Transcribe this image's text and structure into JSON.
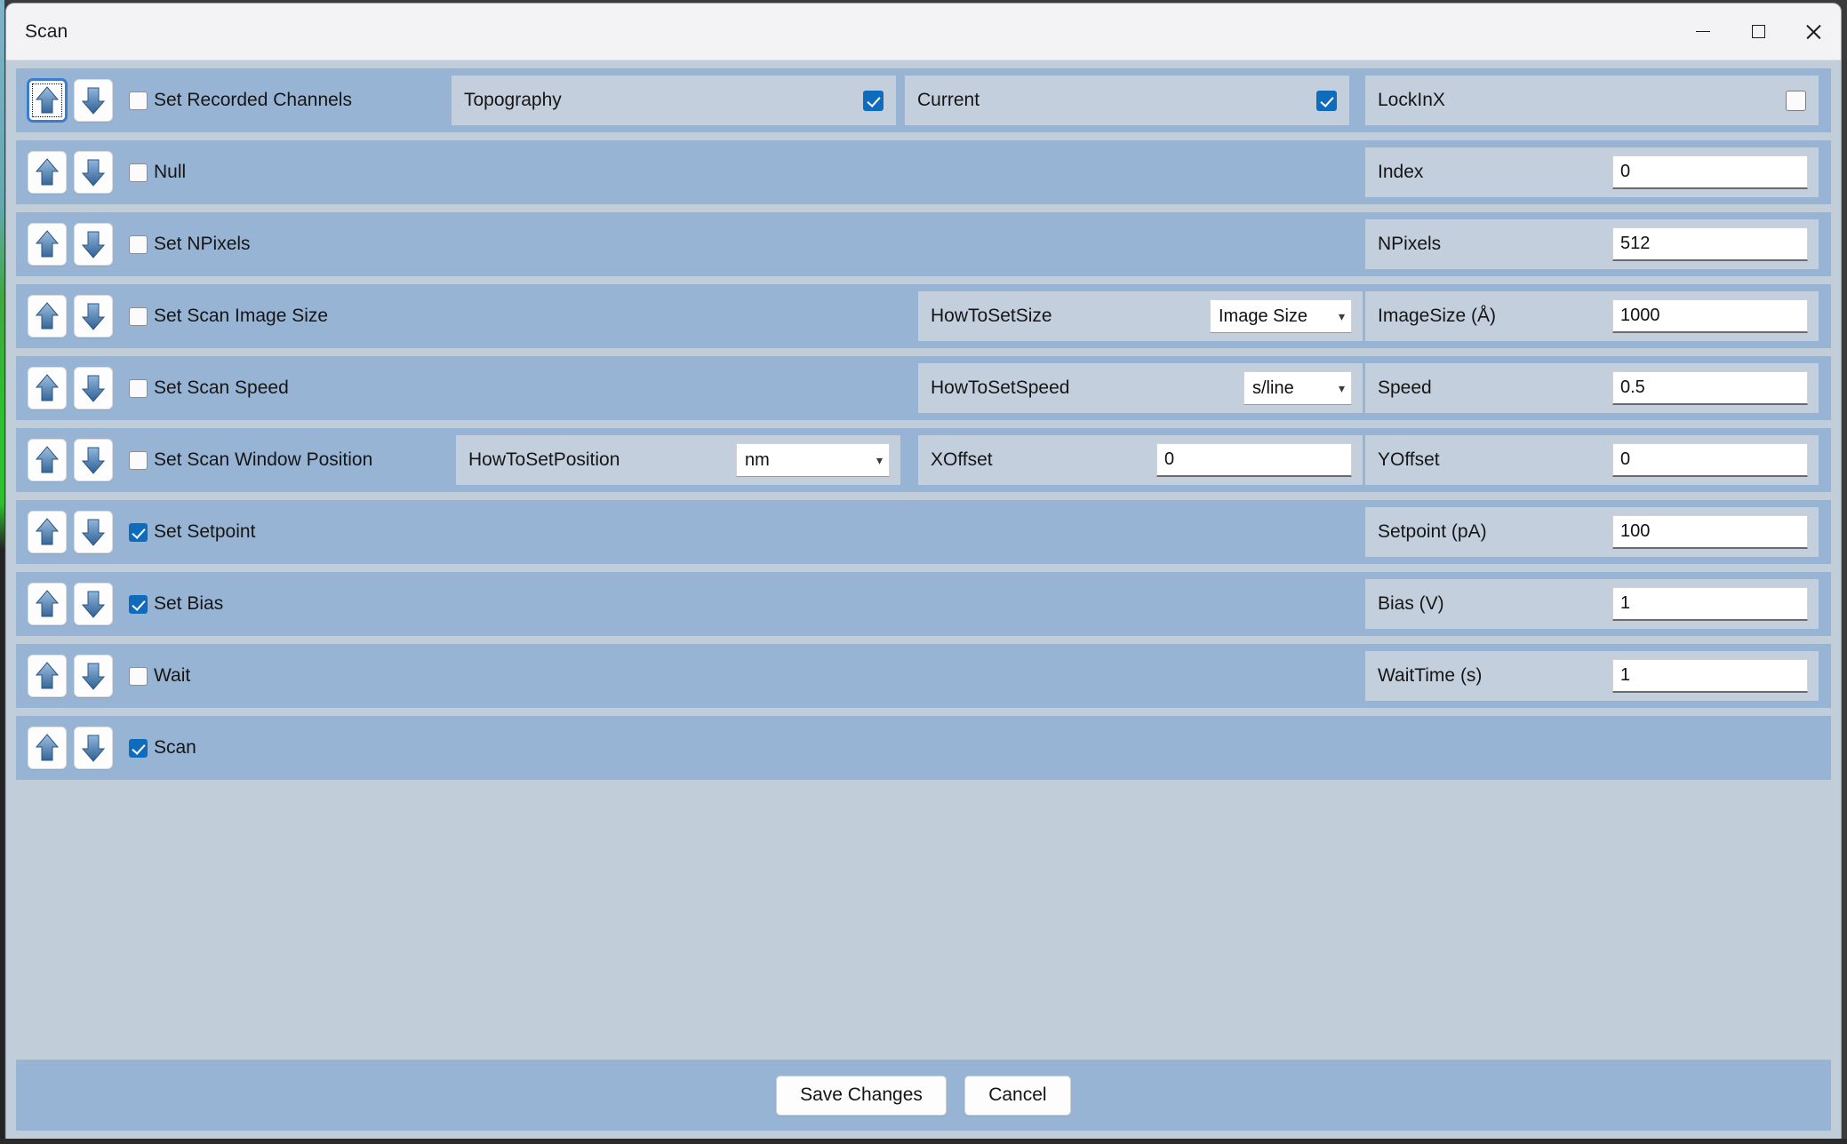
{
  "window": {
    "title": "Scan",
    "controls": {
      "minimize": "minimize-icon",
      "maximize": "maximize-icon",
      "close": "close-icon"
    }
  },
  "colors": {
    "row_background": "#98b4d4",
    "panel_background": "#c4cfdd",
    "dialog_background": "#c2cdda",
    "titlebar_background": "#f3f3f6",
    "accent_checkbox": "#0f6cbd",
    "focus_ring": "#3a7dcf"
  },
  "icons": {
    "move_up": "arrow-up-icon",
    "move_down": "arrow-down-icon",
    "dropdown": "chevron-down-icon"
  },
  "rows": [
    {
      "id": "set-recorded-channels",
      "label": "Set Recorded Channels",
      "checked": false,
      "up_focused": true,
      "channels": [
        {
          "label": "Topography",
          "checked": true
        },
        {
          "label": "Current",
          "checked": true
        },
        {
          "label": "LockInX",
          "checked": false
        }
      ]
    },
    {
      "id": "null",
      "label": "Null",
      "checked": false,
      "up_focused": false,
      "right": {
        "label": "Index",
        "value": "0"
      }
    },
    {
      "id": "set-npixels",
      "label": "Set NPixels",
      "checked": false,
      "up_focused": false,
      "right": {
        "label": "NPixels",
        "value": "512"
      }
    },
    {
      "id": "set-scan-image-size",
      "label": "Set Scan Image Size",
      "checked": false,
      "up_focused": false,
      "middle": {
        "label": "HowToSetSize",
        "type": "combo",
        "value": "Image Size"
      },
      "right": {
        "label": "ImageSize (Å)",
        "value": "1000"
      }
    },
    {
      "id": "set-scan-speed",
      "label": "Set Scan Speed",
      "checked": false,
      "up_focused": false,
      "middle": {
        "label": "HowToSetSpeed",
        "type": "combo",
        "value": "s/line"
      },
      "right": {
        "label": "Speed",
        "value": "0.5"
      }
    },
    {
      "id": "set-scan-window-position",
      "label": "Set Scan Window Position",
      "checked": false,
      "up_focused": false,
      "first": {
        "label": "HowToSetPosition",
        "type": "combo",
        "value": "nm"
      },
      "middle": {
        "label": "XOffset",
        "value": "0"
      },
      "right": {
        "label": "YOffset",
        "value": "0"
      }
    },
    {
      "id": "set-setpoint",
      "label": "Set Setpoint",
      "checked": true,
      "up_focused": false,
      "right": {
        "label": "Setpoint (pA)",
        "value": "100"
      }
    },
    {
      "id": "set-bias",
      "label": "Set Bias",
      "checked": true,
      "up_focused": false,
      "right": {
        "label": "Bias (V)",
        "value": "1"
      }
    },
    {
      "id": "wait",
      "label": "Wait",
      "checked": false,
      "up_focused": false,
      "right": {
        "label": "WaitTime (s)",
        "value": "1"
      }
    },
    {
      "id": "scan",
      "label": "Scan",
      "checked": true,
      "up_focused": false
    }
  ],
  "footer": {
    "save_label": "Save Changes",
    "cancel_label": "Cancel"
  }
}
